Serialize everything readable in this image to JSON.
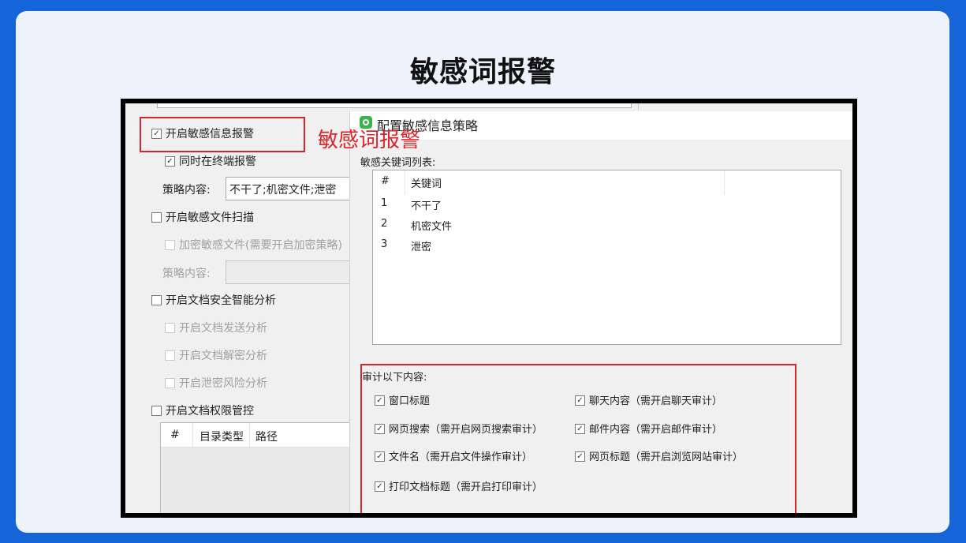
{
  "page": {
    "title": "敏感词报警"
  },
  "left_panel": {
    "enable_sensitive_alert": "开启敏感信息报警",
    "also_terminal_alert": "同时在终端报警",
    "policy_content_label": "策略内容:",
    "policy_content_value": "不干了;机密文件;泄密",
    "enable_file_scan": "开启敏感文件扫描",
    "encrypt_sensitive_files": "加密敏感文件(需要开启加密策略)",
    "policy_content_label_2": "策略内容:",
    "enable_doc_analysis": "开启文档安全智能分析",
    "doc_send_analysis": "开启文档发送分析",
    "doc_decrypt_analysis": "开启文档解密分析",
    "leak_risk_analysis": "开启泄密风险分析",
    "enable_doc_permission": "开启文档权限管控",
    "table_headers": [
      "#",
      "目录类型",
      "路径"
    ]
  },
  "annotation": {
    "label": "敏感词报警",
    "color": "#d9242b"
  },
  "dialog": {
    "title": "配置敏感信息策略",
    "keyword_list_label": "敏感关键词列表:",
    "keyword_headers": [
      "#",
      "关键词"
    ],
    "keywords": [
      {
        "index": "1",
        "word": "不干了"
      },
      {
        "index": "2",
        "word": "机密文件"
      },
      {
        "index": "3",
        "word": "泄密"
      }
    ],
    "audit_label": "审计以下内容:",
    "audit_options": [
      {
        "label": "窗口标题",
        "checked": true
      },
      {
        "label": "聊天内容（需开启聊天审计）",
        "checked": true
      },
      {
        "label": "网页搜索（需开启网页搜索审计）",
        "checked": true
      },
      {
        "label": "邮件内容（需开启邮件审计）",
        "checked": true
      },
      {
        "label": "文件名（需开启文件操作审计）",
        "checked": true
      },
      {
        "label": "网页标题（需开启浏览网站审计）",
        "checked": true
      },
      {
        "label": "打印文档标题（需开启打印审计）",
        "checked": true
      }
    ]
  }
}
